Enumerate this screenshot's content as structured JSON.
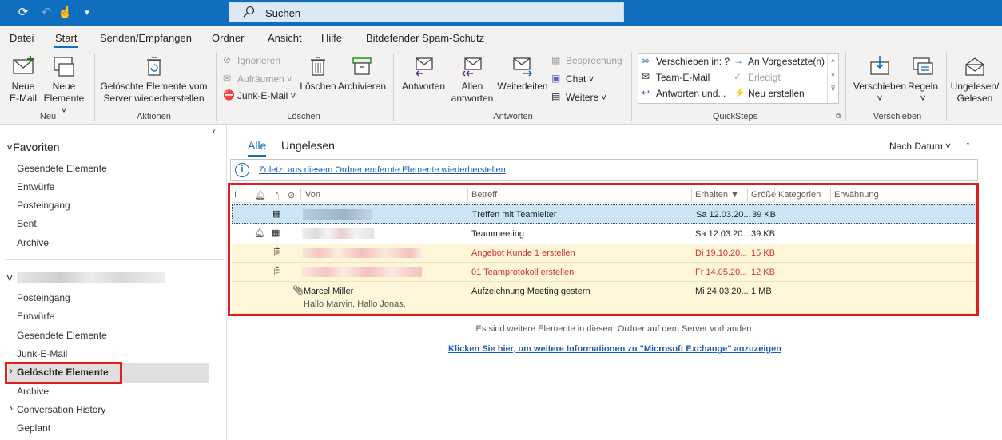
{
  "titlebar": {
    "search_placeholder": "Suchen"
  },
  "menu": {
    "tabs": [
      "Datei",
      "Start",
      "Senden/Empfangen",
      "Ordner",
      "Ansicht",
      "Hilfe",
      "Bitdefender Spam-Schutz"
    ],
    "active": "Start"
  },
  "ribbon": {
    "neu": {
      "new_email": [
        "Neue",
        "E-Mail"
      ],
      "new_items": [
        "Neue",
        "Elemente"
      ],
      "label": "Neu"
    },
    "aktionen": {
      "restore": [
        "Gelöschte Elemente vom",
        "Server wiederherstellen"
      ],
      "label": "Aktionen"
    },
    "loeschen": {
      "ignore": "Ignorieren",
      "cleanup": "Aufräumen",
      "junk": "Junk-E-Mail",
      "delete": "Löschen",
      "archive": "Archivieren",
      "label": "Löschen"
    },
    "antworten": {
      "reply": "Antworten",
      "reply_all": [
        "Allen",
        "antworten"
      ],
      "forward": "Weiterleiten",
      "meeting": "Besprechung",
      "chat": "Chat",
      "more": "Weitere",
      "label": "Antworten"
    },
    "quicksteps": {
      "items": [
        "Verschieben in: ?",
        "An Vorgesetzte(n)",
        "Team-E-Mail",
        "Erledigt",
        "Antworten und...",
        "Neu erstellen"
      ],
      "label": "QuickSteps"
    },
    "verschieben": {
      "move": "Verschieben",
      "rules": "Regeln",
      "label": "Verschieben"
    },
    "unread": [
      "Ungelesen/",
      "Gelesen"
    ]
  },
  "sidebar": {
    "favorites_header": "Favoriten",
    "favorites": [
      "Gesendete Elemente",
      "Entwürfe",
      "Posteingang",
      "Sent",
      "Archive"
    ],
    "account_items": [
      "Posteingang",
      "Entwürfe",
      "Gesendete Elemente",
      "Junk-E-Mail",
      "Gelöschte Elemente",
      "Archive",
      "Conversation History",
      "Geplant"
    ],
    "selected": "Gelöschte Elemente"
  },
  "main": {
    "tabs": [
      "Alle",
      "Ungelesen"
    ],
    "sort_label": "Nach Datum",
    "sort_arrow": "↑",
    "info_link": "Zuletzt aus diesem Ordner entfernte Elemente wiederherstellen",
    "columns": {
      "from": "Von",
      "subject": "Betreff",
      "received": "Erhalten",
      "size": "Größe",
      "categories": "Kategorien",
      "mention": "Erwähnung"
    },
    "rows": [
      {
        "from": "",
        "subject": "Treffen mit Teamleiter",
        "received": "Sa 12.03.20...",
        "size": "39 KB"
      },
      {
        "from": "",
        "subject": "Teammeeting",
        "received": "Sa 12.03.20...",
        "size": "39 KB"
      },
      {
        "from": "",
        "subject": "Angebot Kunde 1 erstellen",
        "received": "Di 19.10.20...",
        "size": "15 KB"
      },
      {
        "from": "",
        "subject": "01 Teamprotokoll erstellen",
        "received": "Fr 14.05.20...",
        "size": "12 KB"
      },
      {
        "from": "Marcel Miller",
        "preview": "Hallo Marvin,  Hallo Jonas,",
        "subject": "Aufzeichnung Meeting gestern",
        "received": "Mi 24.03.20...",
        "size": "1 MB"
      }
    ],
    "footer_text": "Es sind weitere Elemente in diesem Ordner auf dem Server vorhanden.",
    "footer_link": "Klicken Sie hier, um weitere Informationen zu \"Microsoft Exchange\" anzuzeigen"
  },
  "colors": {
    "accent": "#106ebe",
    "highlight_red": "#e02020",
    "task_red": "#d13438",
    "yellow_row": "#fdf6d9"
  }
}
